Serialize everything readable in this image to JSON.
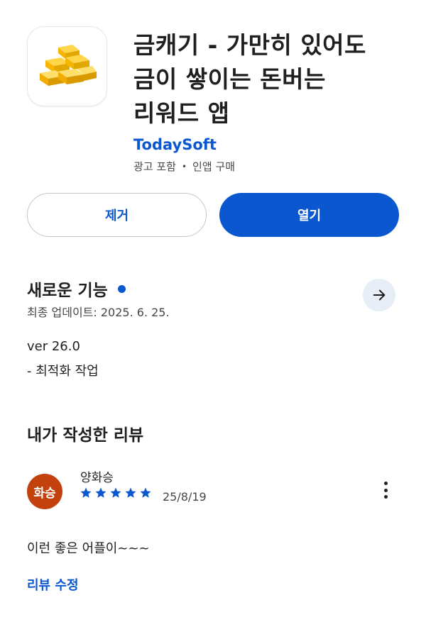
{
  "app": {
    "title_lines": [
      "금캐기 - 가만히 있어도",
      "금이 쌓이는 돈버는",
      "리워드 앱"
    ],
    "developer": "TodaySoft",
    "meta_ads": "광고 포함",
    "meta_separator": "•",
    "meta_iap": "인앱 구매",
    "icon": "gold-bars-icon"
  },
  "actions": {
    "remove_label": "제거",
    "open_label": "열기"
  },
  "whats_new": {
    "title": "새로운 기능",
    "last_update": "최종 업데이트: 2025. 6. 25.",
    "version": "ver 26.0",
    "notes": "- 최적화 작업"
  },
  "my_review": {
    "title": "내가 작성한 리뷰",
    "avatar_text": "화승",
    "reviewer": "양화승",
    "rating": 5,
    "date": "25/8/19",
    "text": "이런 좋은 어플이~~~",
    "edit_label": "리뷰 수정"
  },
  "colors": {
    "accent": "#0b57d0",
    "avatar_bg": "#c2410c"
  }
}
